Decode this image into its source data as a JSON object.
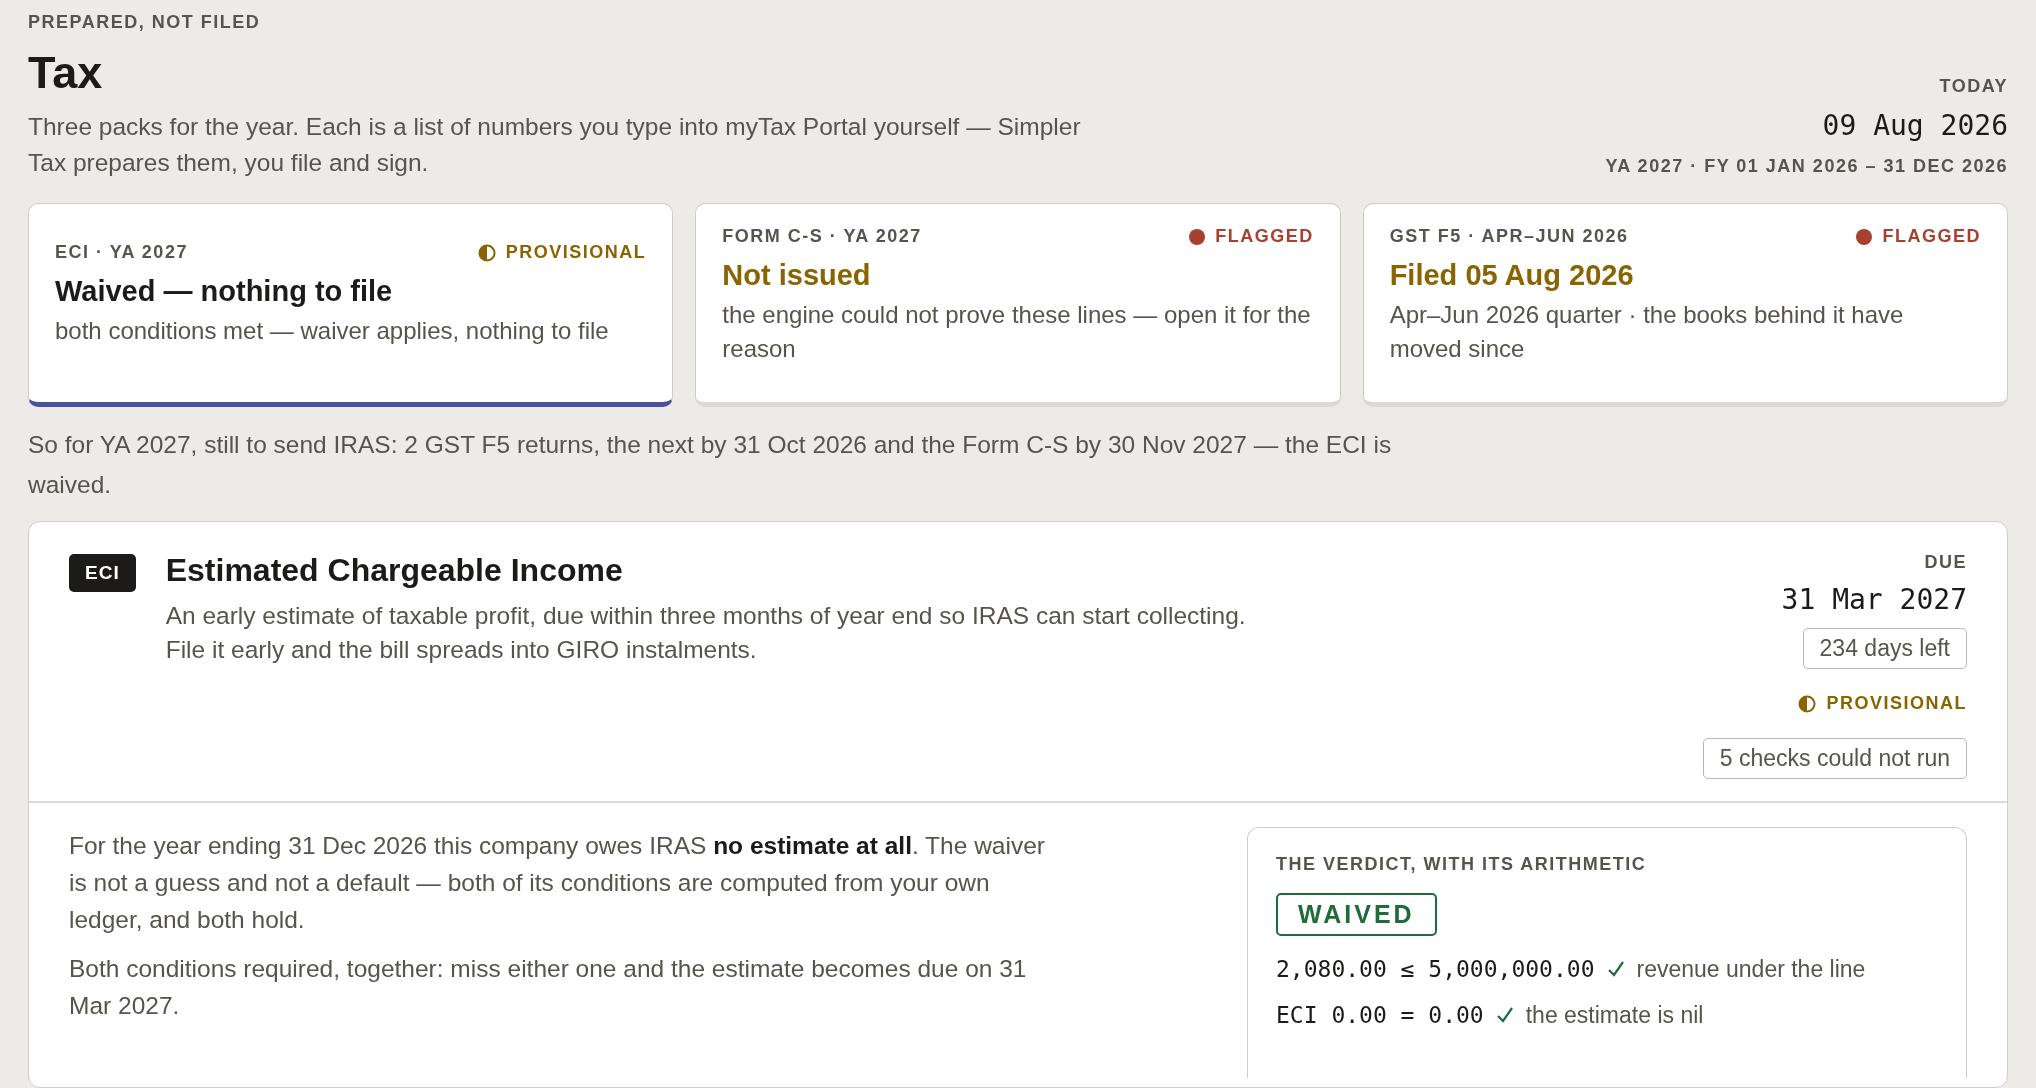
{
  "header": {
    "eyebrow": "PREPARED, NOT FILED",
    "title": "Tax",
    "description": "Three packs for the year. Each is a list of numbers you type into myTax Portal yourself — Simpler Tax prepares them, you file and sign."
  },
  "today": {
    "label": "TODAY",
    "date": "09 Aug 2026",
    "period": "YA 2027 · FY 01 JAN 2026 – 31 DEC 2026"
  },
  "packs": [
    {
      "label": "ECI · YA 2027",
      "status": {
        "kind": "provisional",
        "text": "PROVISIONAL"
      },
      "headline": {
        "kind": "plain",
        "text": "Waived — nothing to file"
      },
      "note": "both conditions met — waiver applies, nothing to file",
      "selected": true
    },
    {
      "label": "FORM C-S · YA 2027",
      "status": {
        "kind": "flagged",
        "text": "FLAGGED"
      },
      "headline": {
        "kind": "warning",
        "text": "Not issued"
      },
      "note": "the engine could not prove these lines — open it for the reason",
      "selected": false
    },
    {
      "label": "GST F5 · APR–JUN 2026",
      "status": {
        "kind": "flagged",
        "text": "FLAGGED"
      },
      "headline": {
        "kind": "warning",
        "text": "Filed 05 Aug 2026"
      },
      "note": "Apr–Jun 2026 quarter · the books behind it have moved since",
      "selected": false
    }
  ],
  "summary": "So for YA 2027, still to send IRAS: 2 GST F5 returns, the next by 31 Oct 2026 and the Form C-S by 30 Nov 2027 — the ECI is waived.",
  "section": {
    "badge": "ECI",
    "title": "Estimated Chargeable Income",
    "description": "An early estimate of taxable profit, due within three months of year end so IRAS can start collecting. File it early and the bill spreads into GIRO instalments.",
    "due_label": "DUE",
    "due_date": "31 Mar 2027",
    "days_left": "234 days left",
    "status": {
      "kind": "provisional",
      "text": "PROVISIONAL"
    },
    "checks": "5 checks could not run",
    "body": [
      "For the year ending 31 Dec 2026 this company owes IRAS **no estimate at all**. The waiver is not a guess and not a default — both of its conditions are computed from your own ledger, and both hold.",
      "Both conditions required, together: miss either one and the estimate becomes due on 31 Mar 2027."
    ],
    "verdict": {
      "title": "THE VERDICT, WITH ITS ARITHMETIC",
      "result": "WAIVED",
      "rows": [
        {
          "expression": "2,080.00 ≤ 5,000,000.00",
          "passed": true,
          "note": "revenue under the line"
        },
        {
          "expression": "ECI 0.00 = 0.00",
          "passed": true,
          "note": "the estimate is nil"
        }
      ]
    }
  }
}
